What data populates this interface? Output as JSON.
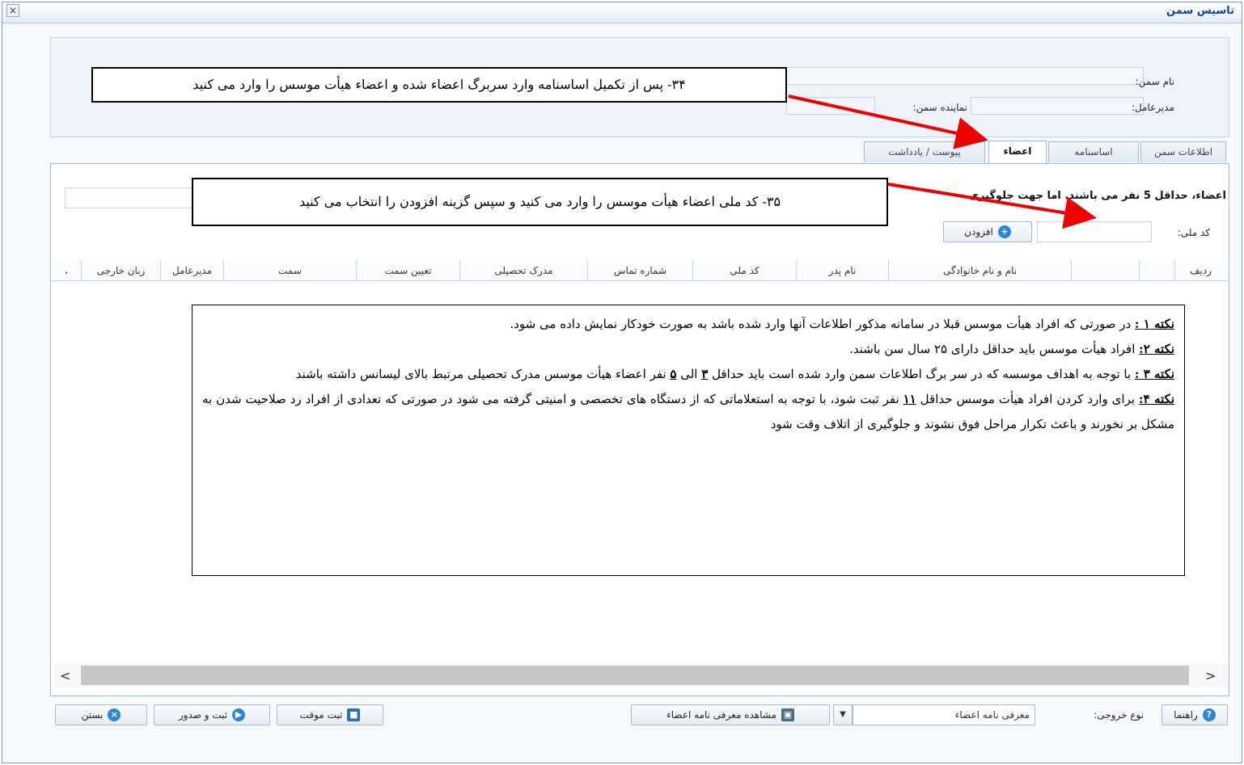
{
  "window": {
    "title": "تاسیس سمن",
    "close_glyph": "×"
  },
  "header_fields": {
    "name_label": "نام سمن:",
    "ceo_label": "مدیرعامل:",
    "rep_label": "نماینده سمن:"
  },
  "tabs": [
    {
      "label": "اطلاعات سمن"
    },
    {
      "label": "اساسنامه"
    },
    {
      "label": "اعضاء"
    },
    {
      "label": "پیوست / یادداشت"
    }
  ],
  "members": {
    "warning": "اعضاء، حداقل 5 نفر می باشند. اما جهت جلوگیری",
    "national_code_label": "کد ملی:",
    "national_code_value": "",
    "add_button": "افزودن"
  },
  "table": {
    "columns": [
      "ردیف",
      "",
      "",
      "نام و نام خانوادگی",
      "نام پدر",
      "کد ملی",
      "شماره تماس",
      "مدرک تحصیلی",
      "تعیین سمت",
      "سمت",
      "مدیرعامل",
      "زبان خارجی",
      "،"
    ]
  },
  "callouts": {
    "c34": "۳۴- پس از تکمیل اساسنامه وارد سربرگ اعضاء شده و اعضاء هیأت موسس را وارد می کنید",
    "c35": "۳۵- کد ملی اعضاء هیأت موسس را وارد می کنید و سپس گزینه افزودن را انتخاب می کنید"
  },
  "notes": [
    {
      "title": "نکته ۱ :",
      "text": " در صورتی که افراد هیأت موسس قبلا در سامانه مذکور اطلاعات آنها وارد شده باشد به صورت خودکار نمایش داده می شود."
    },
    {
      "title": "نکته ۲:",
      "text": " افراد هیأت موسس باید حداقل دارای ۲۵ سال سن باشند."
    },
    {
      "title": "نکته ۳ :",
      "text_a": "  با توجه به اهداف موسسه که در سر برگ اطلاعات سمن وارد شده است باید حداقل ",
      "n1": "۳",
      "text_b": " الی ",
      "n2": "۵",
      "text_c": " نفر اعضاء هیأت موسس مدرک تحصیلی مرتبط بالای لیسانس داشته باشند"
    },
    {
      "title": "نکته ۴:",
      "text_a": "  برای وارد کردن افراد هیأت موسس حداقل ",
      "n1": "۱۱",
      "text_b": " نفر ثبت شود، با توجه به استعلاماتی که از دستگاه های تخصصی و امنیتی گرفته می شود در صورتی که تعدادی از افراد رد صلاحیت شدن به مشکل بر نخورند و باعث تکرار مراحل فوق نشوند و جلوگیری از اتلاف وقت شود"
    }
  ],
  "scroll": {
    "left": "<",
    "right": ">"
  },
  "footer": {
    "help": "راهنما",
    "output_type_label": "نوع خروجی:",
    "output_type_value": "معرفی نامه اعضاء",
    "view_letter": "مشاهده معرفی نامه اعضاء",
    "temp_save": "ثبت موقت",
    "save_issue": "ثبت و صدور",
    "close": "بستن"
  },
  "colors": {
    "accent": "#15428b",
    "arrow": "#ee0000"
  }
}
